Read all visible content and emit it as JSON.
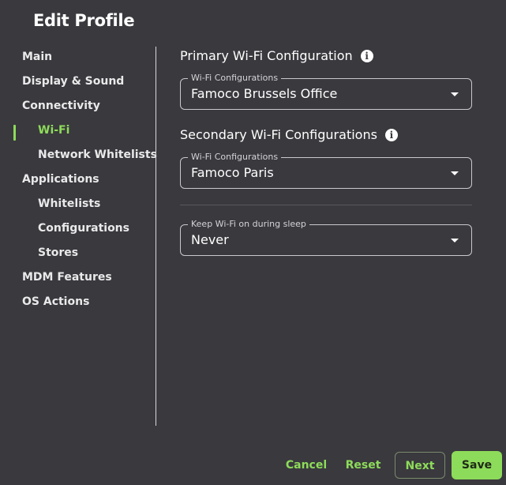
{
  "header": {
    "title": "Edit Profile"
  },
  "sidebar": {
    "items": [
      {
        "label": "Main",
        "level": "top",
        "active": false
      },
      {
        "label": "Display & Sound",
        "level": "top",
        "active": false
      },
      {
        "label": "Connectivity",
        "level": "top",
        "active": false
      },
      {
        "label": "Wi-Fi",
        "level": "sub",
        "active": true
      },
      {
        "label": "Network Whitelists",
        "level": "sub",
        "active": false
      },
      {
        "label": "Applications",
        "level": "top",
        "active": false
      },
      {
        "label": "Whitelists",
        "level": "sub",
        "active": false
      },
      {
        "label": "Configurations",
        "level": "sub",
        "active": false
      },
      {
        "label": "Stores",
        "level": "sub",
        "active": false
      },
      {
        "label": "MDM Features",
        "level": "top",
        "active": false
      },
      {
        "label": "OS Actions",
        "level": "top",
        "active": false
      }
    ]
  },
  "main": {
    "primary": {
      "title": "Primary Wi-Fi Configuration",
      "field_label": "Wi-Fi Configurations",
      "value": "Famoco Brussels Office"
    },
    "secondary": {
      "title": "Secondary Wi-Fi Configurations",
      "field_label": "Wi-Fi Configurations",
      "value": "Famoco Paris"
    },
    "sleep": {
      "field_label": "Keep Wi-Fi on during sleep",
      "value": "Never"
    }
  },
  "footer": {
    "cancel_label": "Cancel",
    "reset_label": "Reset",
    "next_label": "Next",
    "save_label": "Save"
  },
  "icons": {
    "info": "info-icon",
    "dropdown": "caret-down-icon"
  },
  "colors": {
    "accent": "#8ddb5a",
    "background": "#3a393e"
  }
}
